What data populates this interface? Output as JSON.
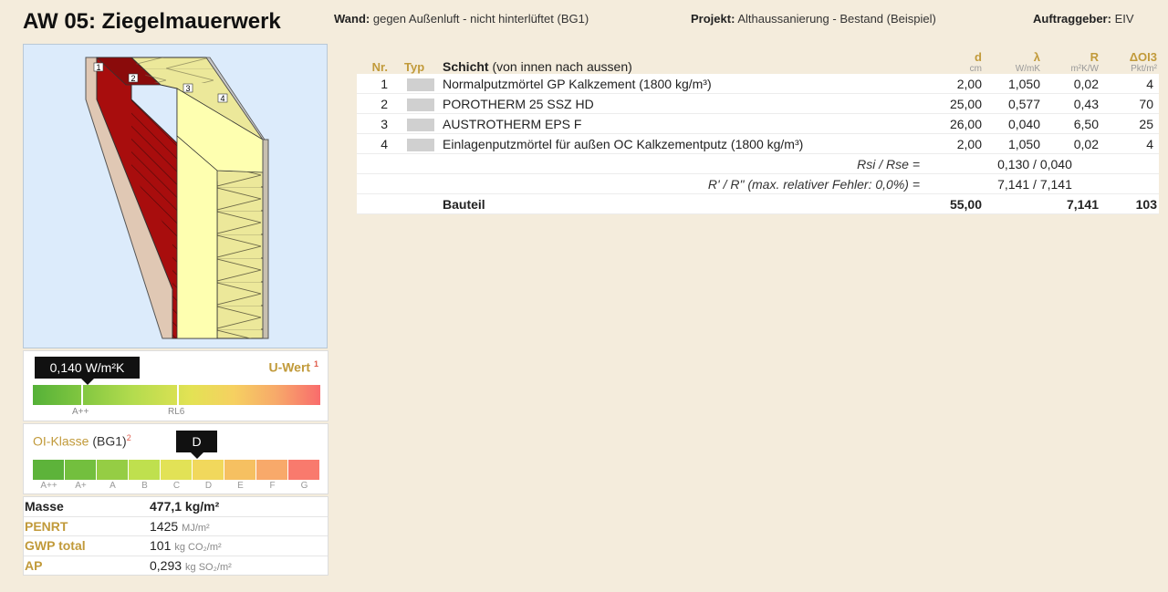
{
  "header": {
    "title": "AW 05: Ziegelmauerwerk",
    "wand_label": "Wand:",
    "wand_value": "gegen Außenluft - nicht hinterlüftet (BG1)",
    "projekt_label": "Projekt:",
    "projekt_value": "Althaussanierung - Bestand (Beispiel)",
    "auftrag_label": "Auftraggeber:",
    "auftrag_value": "EIV"
  },
  "illustration": {
    "layer_numbers": [
      "1",
      "2",
      "3",
      "4"
    ]
  },
  "uwert": {
    "value": "0,140 W/m²K",
    "label": "U-Wert",
    "sup": "1",
    "mark_app": "A++",
    "mark_rl6": "RL6"
  },
  "oi": {
    "label": "OI-Klasse",
    "suffix": "(BG1)",
    "sup": "2",
    "value": "D",
    "classes": [
      "A++",
      "A+",
      "A",
      "B",
      "C",
      "D",
      "E",
      "F",
      "G"
    ],
    "colors": [
      "#5db33a",
      "#73bf3e",
      "#95cd44",
      "#bfe04e",
      "#e2e256",
      "#f1d85c",
      "#f6c061",
      "#f8a96a",
      "#f97a6d"
    ]
  },
  "properties": [
    {
      "name": "Masse",
      "value": "477,1 kg/m²",
      "unit": "",
      "gold": false,
      "bold": true
    },
    {
      "name": "PENRT",
      "value": "1425",
      "unit": "MJ/m²",
      "gold": true,
      "bold": false
    },
    {
      "name": "GWP total",
      "value": "101",
      "unit": "kg CO₂/m²",
      "gold": true,
      "bold": false
    },
    {
      "name": "AP",
      "value": "0,293",
      "unit": "kg SO₂/m²",
      "gold": true,
      "bold": false
    }
  ],
  "table": {
    "headers": {
      "nr": "Nr.",
      "typ": "Typ",
      "schicht": "Schicht",
      "schicht_sub": "(von innen nach aussen)",
      "d": "d",
      "d_unit": "cm",
      "lambda": "λ",
      "lambda_unit": "W/mK",
      "r": "R",
      "r_unit": "m²K/W",
      "oi": "ΔOI3",
      "oi_unit": "Pkt/m²"
    },
    "rows": [
      {
        "nr": "1",
        "name": "Normalputzmörtel GP Kalkzement (1800 kg/m³)",
        "d": "2,00",
        "lambda": "1,050",
        "r": "0,02",
        "oi": "4"
      },
      {
        "nr": "2",
        "name": "POROTHERM 25 SSZ HD",
        "d": "25,00",
        "lambda": "0,577",
        "r": "0,43",
        "oi": "70"
      },
      {
        "nr": "3",
        "name": "AUSTROTHERM EPS F",
        "d": "26,00",
        "lambda": "0,040",
        "r": "6,50",
        "oi": "25"
      },
      {
        "nr": "4",
        "name": "Einlagenputzmörtel für außen OC Kalkzementputz (1800 kg/m³)",
        "d": "2,00",
        "lambda": "1,050",
        "r": "0,02",
        "oi": "4"
      }
    ],
    "rsi_label": "Rsi / Rse =",
    "rsi_value": "0,130 / 0,040",
    "rr_label": "R' / R\" (max. relativer Fehler: 0,0%) =",
    "rr_value": "7,141 / 7,141",
    "total_label": "Bauteil",
    "total_d": "55,00",
    "total_r": "7,141",
    "total_oi": "103"
  }
}
